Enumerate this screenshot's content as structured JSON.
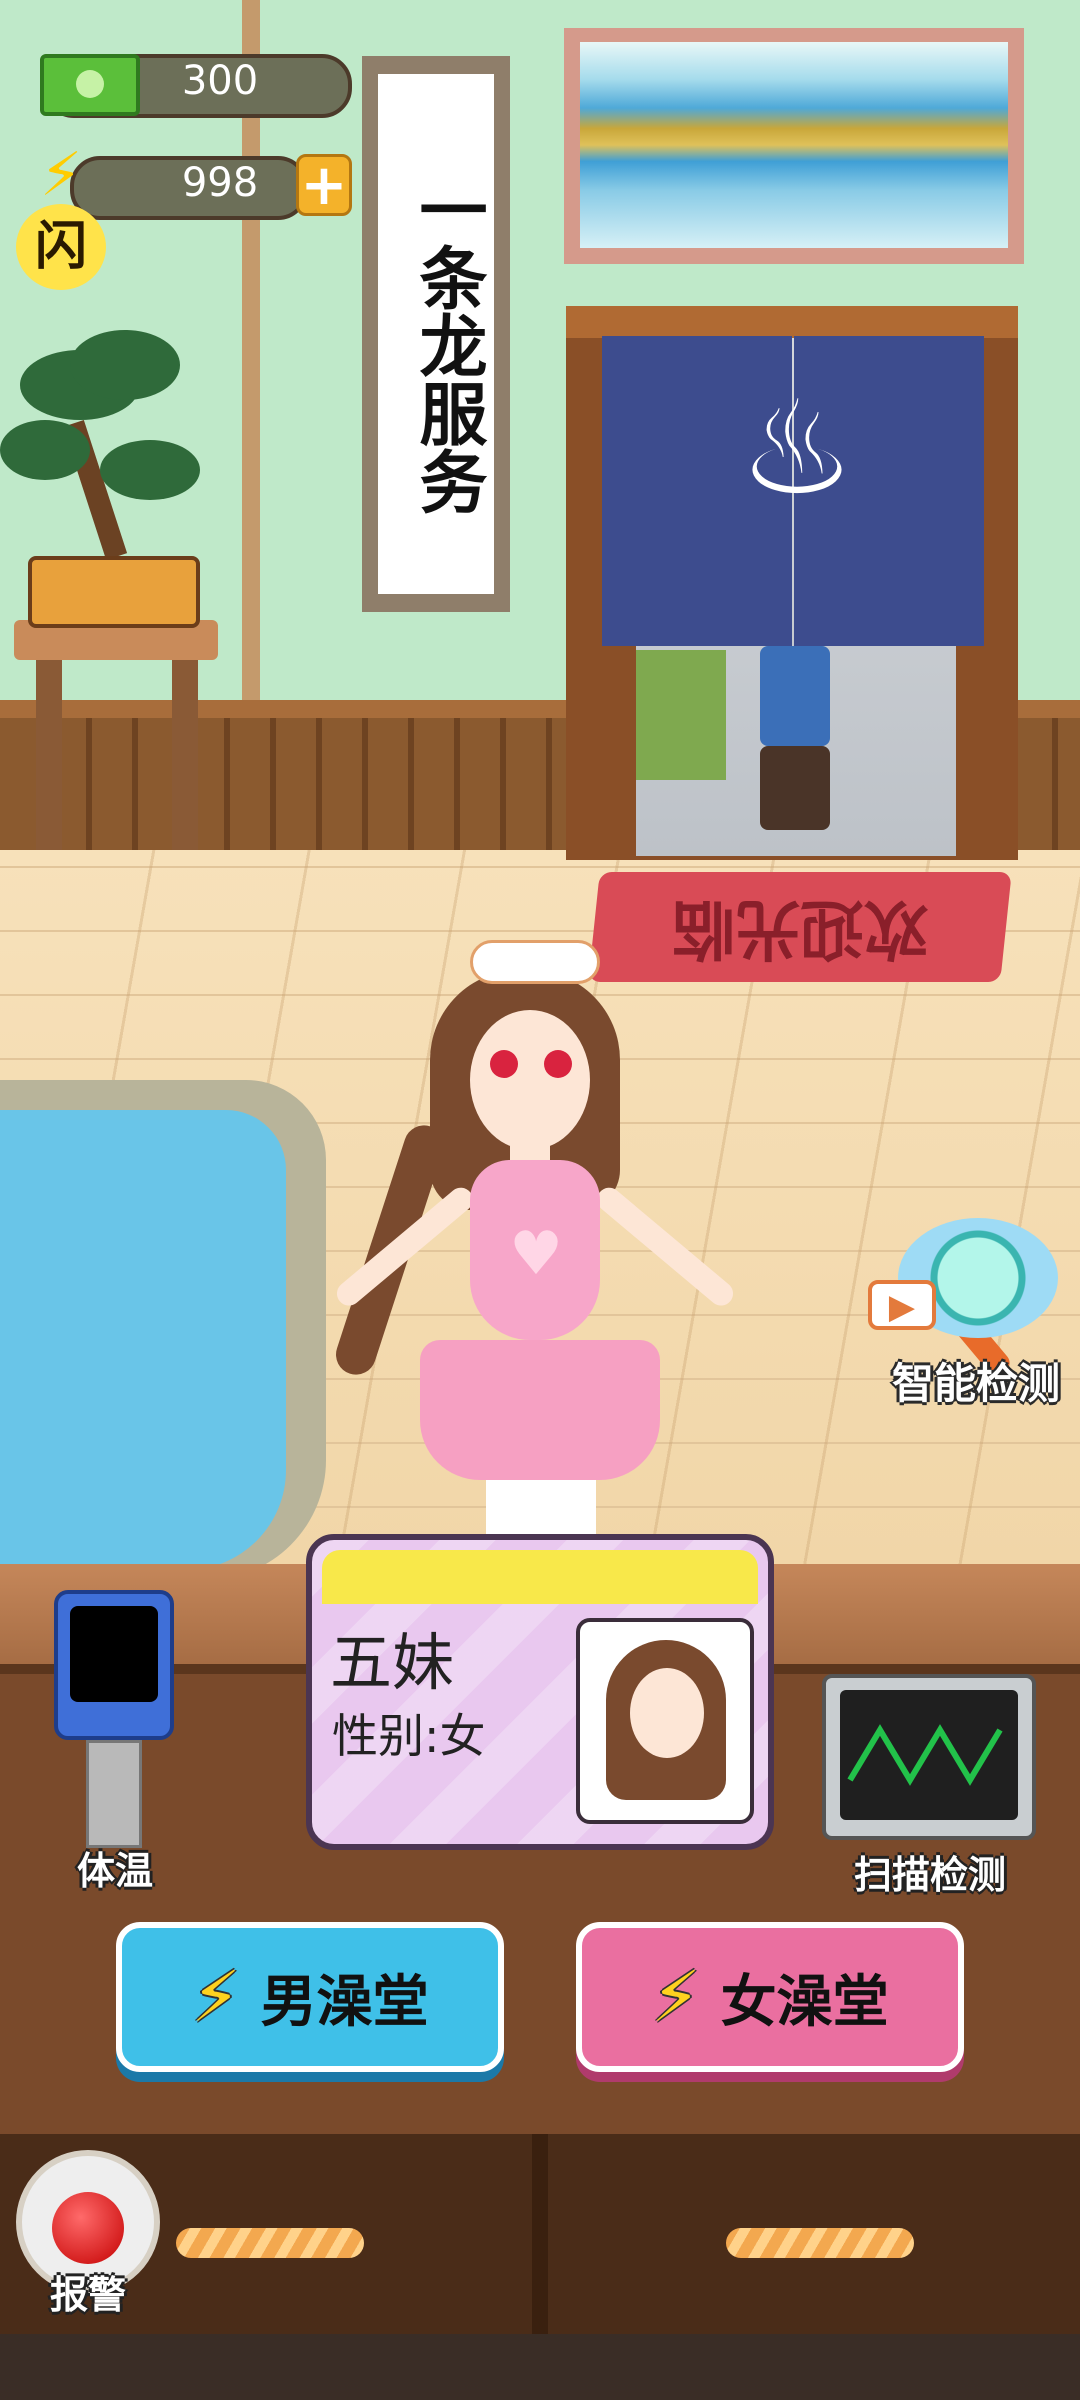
{
  "hud": {
    "money": "300",
    "energy": "998",
    "plus_icon": "plus",
    "flash_badge": "闪"
  },
  "wall": {
    "scroll_text": "一条龙服务",
    "welcome_mat": "欢迎光临",
    "onsen_symbol": "♨"
  },
  "tools": {
    "smart_detect_label": "智能检测",
    "thermometer_label": "体温",
    "scan_label": "扫描检测",
    "alarm_label": "报警"
  },
  "card": {
    "name": "五妹",
    "gender": "性别:女"
  },
  "buttons": {
    "male": "男澡堂",
    "female": "女澡堂",
    "bolt_icon": "⚡"
  },
  "colors": {
    "male_button": "#3fc0e8",
    "female_button": "#ea6fa0",
    "card_stripe": "#f8e84a"
  }
}
